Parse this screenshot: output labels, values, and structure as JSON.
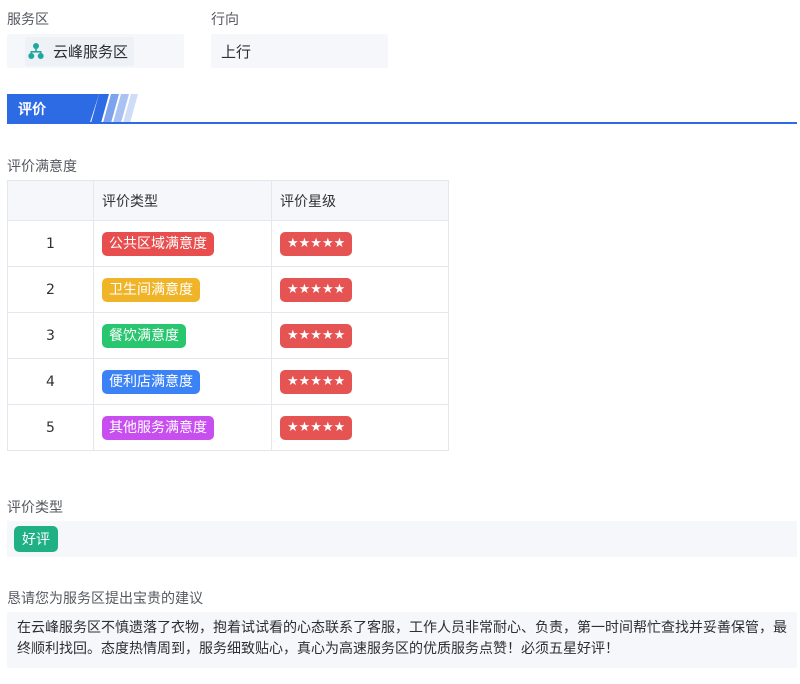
{
  "service_area": {
    "label": "服务区",
    "value": "云峰服务区",
    "icon": "org-tree-icon",
    "icon_color": "#1fa8a0"
  },
  "direction": {
    "label": "行向",
    "value": "上行"
  },
  "section": {
    "tab_label": "评价",
    "accent_color": "#2d6be4"
  },
  "satisfaction": {
    "title": "评价满意度",
    "headers": [
      "",
      "评价类型",
      "评价星级"
    ],
    "rows": [
      {
        "index": "1",
        "type": "公共区域满意度",
        "color": "#e84e4e",
        "stars": "★★★★★"
      },
      {
        "index": "2",
        "type": "卫生间满意度",
        "color": "#f0b429",
        "stars": "★★★★★"
      },
      {
        "index": "3",
        "type": "餐饮满意度",
        "color": "#28c66e",
        "stars": "★★★★★"
      },
      {
        "index": "4",
        "type": "便利店满意度",
        "color": "#3b82f6",
        "stars": "★★★★★"
      },
      {
        "index": "5",
        "type": "其他服务满意度",
        "color": "#c84ef0",
        "stars": "★★★★★"
      }
    ],
    "star_color": "#e55353"
  },
  "evaluation_type": {
    "label": "评价类型",
    "value": "好评",
    "color": "#1fb184"
  },
  "suggestion": {
    "label": "恳请您为服务区提出宝贵的建议",
    "text": "在云峰服务区不慎遗落了衣物，抱着试试看的心态联系了客服，工作人员非常耐心、负责，第一时间帮忙查找并妥善保管，最终顺利找回。态度热情周到，服务细致贴心，真心为高速服务区的优质服务点赞！必须五星好评！"
  }
}
